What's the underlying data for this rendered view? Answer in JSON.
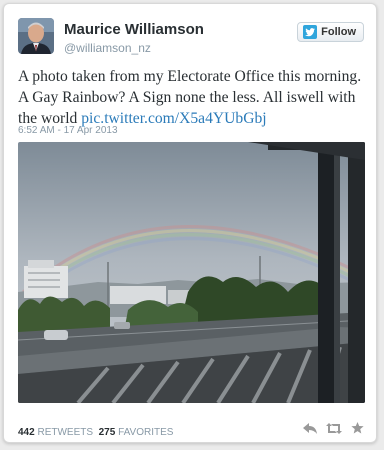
{
  "user": {
    "name": "Maurice Williamson",
    "handle": "@williamson_nz"
  },
  "follow_label": "Follow",
  "tweet": {
    "text": "A photo taken from my Electorate Office this morning. A Gay Rainbow? A Sign none the less. All iswell with the world",
    "link": "pic.twitter.com/X5a4YUbGbj",
    "timestamp": "6:52 AM - 17 Apr 2013"
  },
  "stats": {
    "retweets_count": "442",
    "retweets_label": "RETWEETS",
    "favorites_count": "275",
    "favorites_label": "FAVORITES"
  },
  "icons": {
    "follow": "twitter-bird-icon",
    "reply": "reply-icon",
    "retweet": "retweet-icon",
    "favorite": "star-icon"
  },
  "colors": {
    "link": "#2b7bb9",
    "name": "#292f33",
    "meta": "#8899a6",
    "bird": "#2fa5dc"
  }
}
